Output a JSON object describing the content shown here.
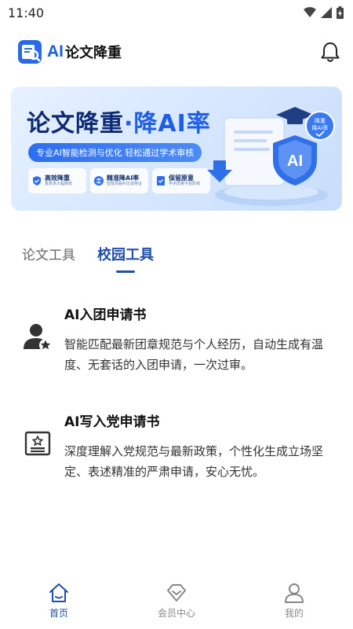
{
  "status_bar": {
    "time": "11:40"
  },
  "header": {
    "brand_ai": "AI",
    "brand_cn": "论文降重"
  },
  "banner": {
    "title_main": "论文降重",
    "title_sep": "·",
    "title_accent": "降AI率",
    "subtitle": "专业AI智能检测与优化  轻松通过学术审核",
    "features": [
      {
        "title": "高效降重",
        "desc": "重复率大幅降低"
      },
      {
        "title": "精准降AI率",
        "desc": "智能规避AI生成特征"
      },
      {
        "title": "保留原意",
        "desc": "学术质量不受影响"
      }
    ],
    "badge_line1": "降重",
    "badge_line2": "降AI率",
    "shield_text": "AI"
  },
  "tabs": [
    {
      "label": "论文工具",
      "active": false
    },
    {
      "label": "校园工具",
      "active": true
    }
  ],
  "items": [
    {
      "title": "AI入团申请书",
      "desc": "智能匹配最新团章规范与个人经历，自动生成有温度、无套话的入团申请，一次过审。"
    },
    {
      "title": "AI写入党申请书",
      "desc": "深度理解入党规范与最新政策，个性化生成立场坚定、表述精准的严肃申请，安心无忧。"
    }
  ],
  "bottom_nav": [
    {
      "label": "首页",
      "icon": "home-icon",
      "active": true
    },
    {
      "label": "会员中心",
      "icon": "diamond-icon",
      "active": false
    },
    {
      "label": "我的",
      "icon": "user-icon",
      "active": false
    }
  ],
  "colors": {
    "primary": "#1f4fa8",
    "brand_blue": "#1e5fd8"
  }
}
